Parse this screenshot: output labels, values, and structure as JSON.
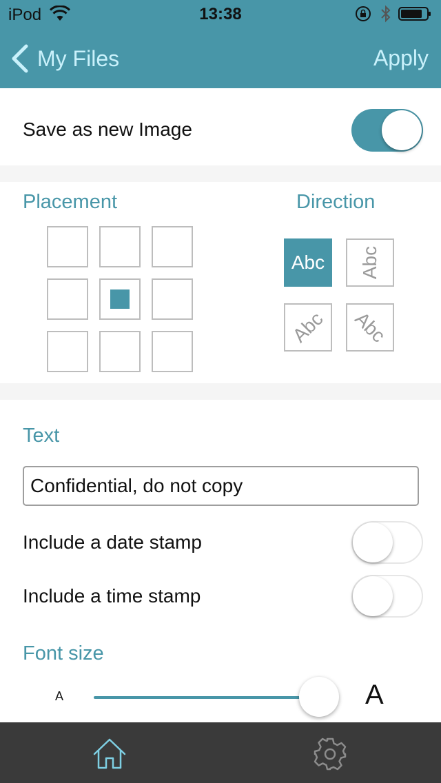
{
  "status_bar": {
    "carrier": "iPod",
    "time": "13:38"
  },
  "nav": {
    "back_label": "My Files",
    "action_label": "Apply"
  },
  "save_section": {
    "label": "Save as new Image",
    "enabled": true
  },
  "placement": {
    "title": "Placement",
    "selected_cell": 4
  },
  "direction": {
    "title": "Direction",
    "options": [
      {
        "label": "Abc",
        "orientation": "horizontal",
        "selected": true
      },
      {
        "label": "Abc",
        "orientation": "vertical-up",
        "selected": false
      },
      {
        "label": "Abc",
        "orientation": "diagonal-up",
        "selected": false
      },
      {
        "label": "Abc",
        "orientation": "diagonal-down",
        "selected": false
      }
    ]
  },
  "text_section": {
    "title": "Text",
    "input_value": "Confidential, do not copy",
    "date_stamp_label": "Include a date stamp",
    "date_stamp_enabled": false,
    "time_stamp_label": "Include a time stamp",
    "time_stamp_enabled": false
  },
  "font_size": {
    "title": "Font size",
    "small_label": "A",
    "large_label": "A",
    "value_fraction": 0.9
  },
  "tab_bar": {
    "tabs": [
      {
        "name": "home",
        "icon": "home-icon",
        "active": true
      },
      {
        "name": "settings",
        "icon": "gear-icon",
        "active": false
      }
    ]
  },
  "colors": {
    "accent": "#4896a8",
    "nav_text": "#c9f1fb",
    "tab_bar": "#3a3a3a"
  }
}
